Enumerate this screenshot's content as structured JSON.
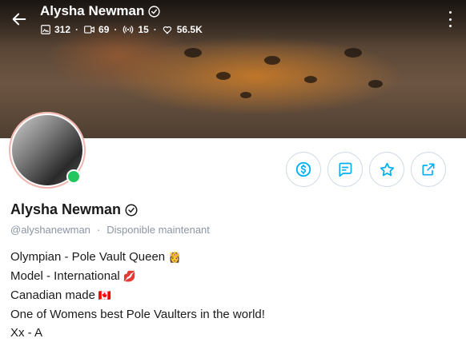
{
  "header": {
    "name": "Alysha Newman",
    "stats": [
      {
        "icon": "photo-icon",
        "value": "312"
      },
      {
        "icon": "video-icon",
        "value": "69"
      },
      {
        "icon": "broadcast-icon",
        "value": "15"
      },
      {
        "icon": "heart-icon",
        "value": "56.5K"
      }
    ]
  },
  "profile": {
    "name": "Alysha Newman",
    "handle": "@alyshanewman",
    "status": "Disponible maintenant",
    "online": true
  },
  "actions": [
    {
      "name": "tip-button",
      "icon": "dollar-icon"
    },
    {
      "name": "message-button",
      "icon": "message-icon"
    },
    {
      "name": "favorite-button",
      "icon": "star-icon"
    },
    {
      "name": "share-button",
      "icon": "share-icon"
    }
  ],
  "bio": [
    {
      "text": "Olympian - Pole Vault Queen",
      "emoji": "👸"
    },
    {
      "text": "Model - International",
      "emoji": "💋"
    },
    {
      "text": "Canadian made",
      "emoji": "🇨🇦"
    },
    {
      "text": "One of Womens best Pole Vaulters in the world!",
      "emoji": ""
    },
    {
      "text": "Xx - A",
      "emoji": ""
    }
  ],
  "colors": {
    "accent": "#00aff0",
    "online": "#22c55e",
    "muted": "#8a96a3",
    "button_border": "#cfd8e6"
  }
}
